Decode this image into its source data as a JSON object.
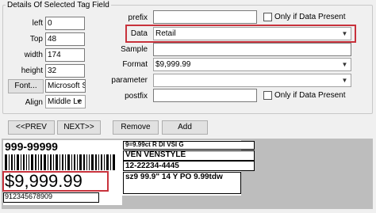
{
  "group": {
    "title": "Details Of Selected Tag Field"
  },
  "left_fields": {
    "left": {
      "label": "left",
      "value": "0"
    },
    "top": {
      "label": "Top",
      "value": "48"
    },
    "width": {
      "label": "width",
      "value": "174"
    },
    "height": {
      "label": "height",
      "value": "32"
    },
    "font": {
      "button": "Font...",
      "value": "Microsoft Sa"
    },
    "align": {
      "label": "Align",
      "value": "Middle Le"
    }
  },
  "right_fields": {
    "prefix": {
      "label": "prefix",
      "value": "",
      "checkbox": "Only if Data Present"
    },
    "data": {
      "label": "Data",
      "value": "Retail"
    },
    "sample": {
      "label": "Sample",
      "value": ""
    },
    "format": {
      "label": "Format",
      "value": "$9,999.99"
    },
    "parameter": {
      "label": "parameter",
      "value": ""
    },
    "postfix": {
      "label": "postfix",
      "value": "",
      "checkbox": "Only if Data Present"
    }
  },
  "buttons": {
    "prev": "<<PREV",
    "next": "NEXT>>",
    "remove": "Remove",
    "add": "Add"
  },
  "label_preview": {
    "code": "999-99999",
    "price": "$9,999.99",
    "upc": "912345678909",
    "line1": "9=9.99ct R DI VSI G",
    "line2": "VEN VENSTYLE",
    "line3": "12-22234-4445",
    "line4": "sz9 99.9\" 14 Y PO 9.99tdw"
  },
  "colors": {
    "highlight": "#c8323c",
    "preview_background": "#bdbdbd"
  },
  "icons": {
    "dropdown": "chevron-down-icon"
  }
}
